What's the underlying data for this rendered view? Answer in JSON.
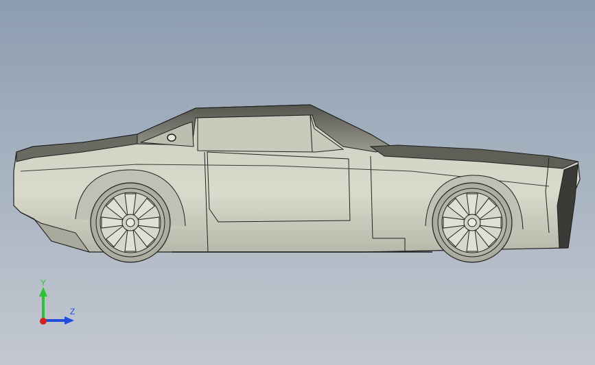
{
  "viewport": {
    "background_top": "#8c9db0",
    "background_bottom": "#c3c8d0"
  },
  "model": {
    "body_color": "#d2d2c4",
    "shadow_color": "#8a8a80",
    "edge_color": "#1e1e1e",
    "wheel_color": "#cfcfc2",
    "view": "side (right)"
  },
  "triad": {
    "y_label": "Y",
    "z_label": "Z",
    "y_color": "#2fbf3a",
    "z_color": "#1f4fd8",
    "origin_color": "#d42020"
  }
}
